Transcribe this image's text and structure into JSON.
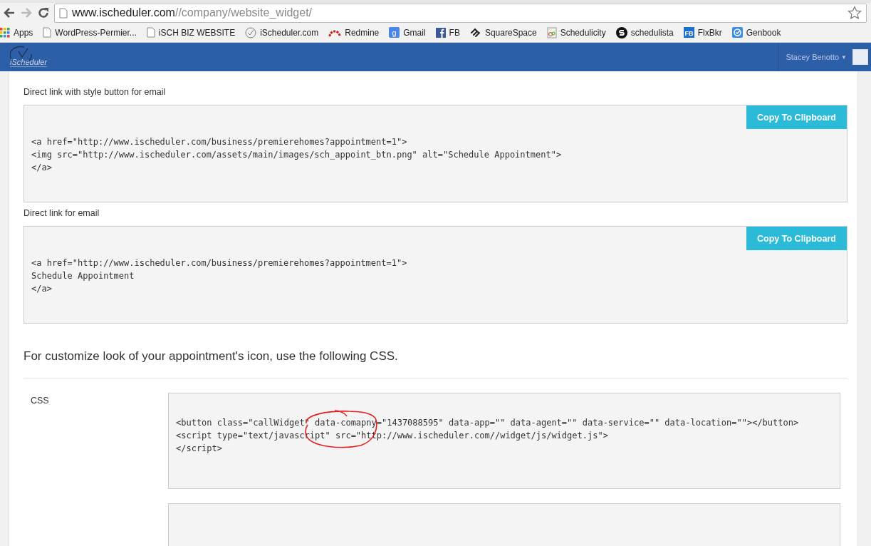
{
  "address_bar": {
    "host": "www.ischeduler.com",
    "path": "//company/website_widget/"
  },
  "bookmarks": [
    {
      "label": "Apps",
      "kind": "apps"
    },
    {
      "label": "WordPress-Permier...",
      "kind": "page"
    },
    {
      "label": "iSCH BIZ WEBSITE",
      "kind": "page"
    },
    {
      "label": "iScheduler.com",
      "kind": "clock"
    },
    {
      "label": "Redmine",
      "kind": "redmine"
    },
    {
      "label": "Gmail",
      "kind": "gmail",
      "icon_text": "g"
    },
    {
      "label": "FB",
      "kind": "facebook"
    },
    {
      "label": "SquareSpace",
      "kind": "squarespace"
    },
    {
      "label": "Schedulicity",
      "kind": "schedulicity"
    },
    {
      "label": "schedulista",
      "kind": "schedulista"
    },
    {
      "label": "FlxBkr",
      "kind": "flxbkr",
      "icon_text": "FB"
    },
    {
      "label": "Genbook",
      "kind": "genbook"
    }
  ],
  "header": {
    "logo": "iScheduler",
    "user_name": "Stacey Benotto",
    "caret": "▼"
  },
  "link_sections": [
    {
      "label": "Direct link with style button for email",
      "button": "Copy To Clipboard",
      "code_lines": [
        "<a href=\"http://www.ischeduler.com/business/premierehomes?appointment=1\">",
        "<img src=\"http://www.ischeduler.com/assets/main/images/sch_appoint_btn.png\" alt=\"Schedule Appointment\">",
        "</a>"
      ]
    },
    {
      "label": "Direct link for email",
      "button": "Copy To Clipboard",
      "code_lines": [
        "<a href=\"http://www.ischeduler.com/business/premierehomes?appointment=1\">",
        "Schedule Appointment",
        "</a>"
      ]
    }
  ],
  "css_section": {
    "heading": "For customize look of your appointment's icon, use the following CSS.",
    "label": "CSS",
    "code_lines": [
      "<button class=\"callWidget\" data-comapny=\"1437088595\" data-app=\"\" data-agent=\"\" data-service=\"\" data-location=\"\"></button>",
      "<script type=\"text/javascript\" src=\"http://www.ischeduler.com//widget/js/widget.js\">",
      "</script>"
    ]
  }
}
